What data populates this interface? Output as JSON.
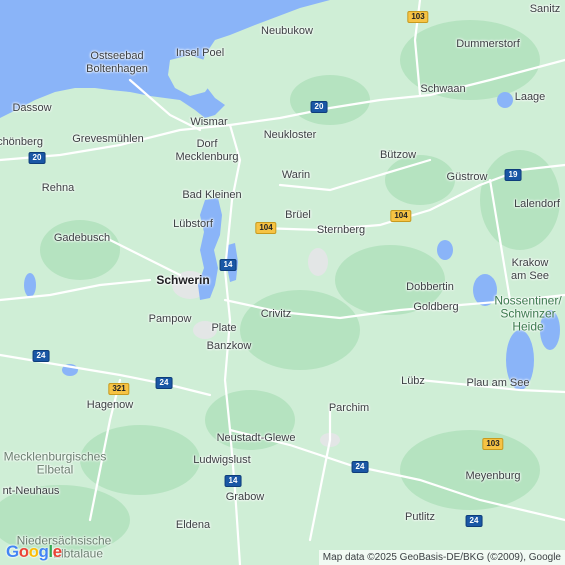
{
  "map": {
    "colors": {
      "land": "#cfeed6",
      "water": "#8ab4f8",
      "forest": "#b5e3c0",
      "road": "#ffffff",
      "urban": "#e8eaed"
    },
    "attribution": "Map data ©2025 GeoBasis-DE/BKG (©2009), Google",
    "logo": [
      "G",
      "o",
      "o",
      "g",
      "l",
      "e"
    ],
    "logo_colors": [
      "#4285f4",
      "#ea4335",
      "#fbbc05",
      "#4285f4",
      "#34a853",
      "#ea4335"
    ],
    "labels": {
      "sanitz": "Sanitz",
      "neubukow": "Neubukow",
      "dummerstorf": "Dummerstorf",
      "ostseebad": "Ostseebad",
      "boltenhagen": "Boltenhagen",
      "insel_poel": "Insel Poel",
      "schwaan": "Schwaan",
      "laage": "Laage",
      "dassow": "Dassow",
      "wismar": "Wismar",
      "neukloster": "Neukloster",
      "schonberg": "chönberg",
      "grevesmuhlen": "Grevesmühlen",
      "dorf": "Dorf",
      "mecklenburg": "Mecklenburg",
      "butzow": "Bützow",
      "rehna": "Rehna",
      "warin": "Warin",
      "gustrow": "Güstrow",
      "bad_kleinen": "Bad Kleinen",
      "lalendorf": "Lalendorf",
      "bruel": "Brüel",
      "lubstorf": "Lübstorf",
      "sternberg": "Sternberg",
      "gadebusch": "Gadebusch",
      "krakow": "Krakow",
      "am_see": "am See",
      "schwerin": "Schwerin",
      "dobbertin": "Dobbertin",
      "nossentiner": "Nossentiner/",
      "schwinzer": "Schwinzer",
      "heide": "Heide",
      "pampow": "Pampow",
      "crivitz": "Crivitz",
      "goldberg": "Goldberg",
      "plate": "Plate",
      "banzkow": "Banzkow",
      "lubz": "Lübz",
      "plau": "Plau am See",
      "hagenow": "Hagenow",
      "parchim": "Parchim",
      "neustadt": "Neustadt-Glewe",
      "mecklenburgisches": "Mecklenburgisches",
      "elbetal": "Elbetal",
      "ludwigslust": "Ludwigslust",
      "meyenburg": "Meyenburg",
      "neuhaus": "nt-Neuhaus",
      "grabow": "Grabow",
      "putlitz": "Putlitz",
      "eldena": "Eldena",
      "niedersachsische": "Niedersächsische",
      "elbtalaue": "Elbtalaue"
    },
    "shields": [
      "103",
      "20",
      "19",
      "104",
      "104",
      "14",
      "24",
      "321",
      "24",
      "103",
      "24",
      "14",
      "24"
    ]
  }
}
